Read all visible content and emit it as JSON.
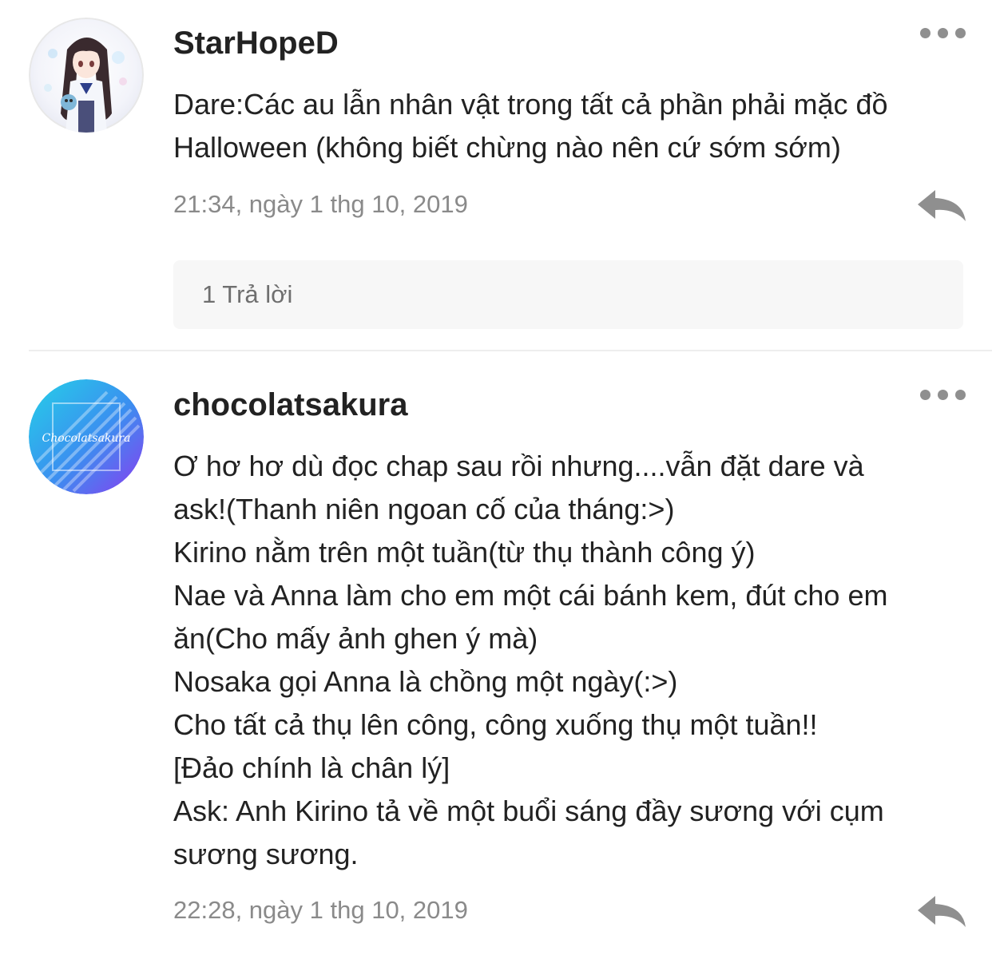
{
  "comments": [
    {
      "username": "StarHopeD",
      "avatar": "anime-girl-avatar",
      "lines": [
        "Dare:Các au lẫn nhân vật trong tất cả phần phải mặc đồ",
        "Halloween (không biết chừng nào nên cứ sớm sớm)"
      ],
      "timestamp": "21:34, ngày 1 thg 10, 2019",
      "replies_label": "1 Trả lời"
    },
    {
      "username": "chocolatsakura",
      "avatar": "chocolatsakura-logo-avatar",
      "avatar_text": "Chocolatsakura",
      "lines": [
        "Ơ hơ hơ dù đọc chap sau rồi nhưng....vẫn đặt dare và",
        "ask!(Thanh niên ngoan cố của tháng:>)",
        "Kirino nằm trên một tuần(từ thụ thành công ý)",
        "Nae và Anna làm cho em một cái bánh kem, đút cho em",
        "ăn(Cho mấy ảnh ghen ý mà)",
        "Nosaka gọi Anna là chồng một ngày(:>)",
        "Cho tất cả thụ lên công, công xuống thụ một tuần!!",
        "[Đảo chính là chân lý]",
        "Ask: Anh Kirino tả về một buổi sáng đầy sương với cụm",
        "sương sương."
      ],
      "timestamp": "22:28, ngày 1 thg 10, 2019"
    }
  ],
  "icons": {
    "more": "more-horizontal-icon",
    "reply": "reply-arrow-icon"
  },
  "colors": {
    "text": "#222222",
    "meta": "#8a8a8a",
    "icon": "#8f8f8f",
    "reply_box_bg": "#f7f7f7",
    "avatar_gradient_start": "#25d0e8",
    "avatar_gradient_end": "#8a3cf0"
  }
}
